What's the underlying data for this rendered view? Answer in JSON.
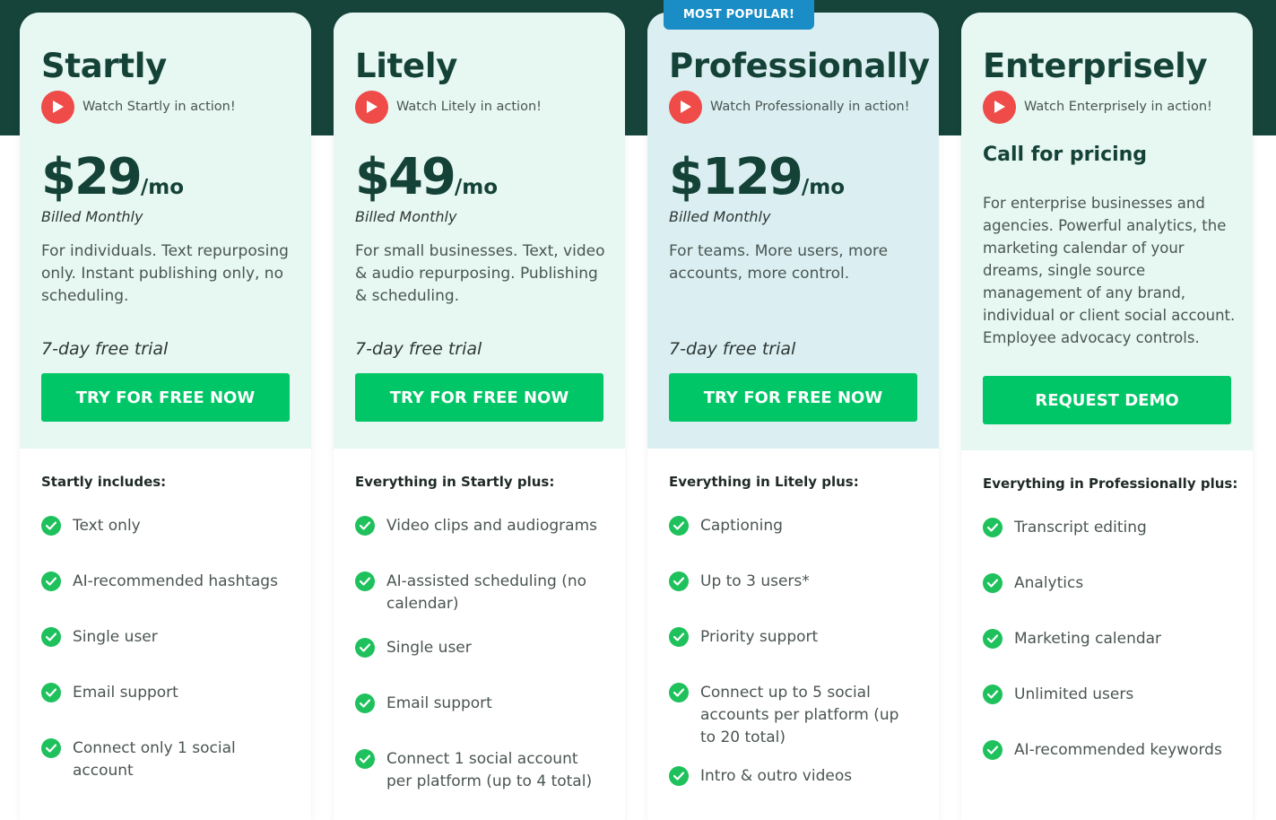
{
  "badge": "MOST POPULAR!",
  "colors": {
    "header_band": "#16443a",
    "card_top": "#e7f7f2",
    "card_top_popular": "#dbeff2",
    "cta_green": "#00c667",
    "play_red": "#ee4b49",
    "check_green": "#1ec15c",
    "badge_blue": "#1a8dc6"
  },
  "icons": {
    "watch": "play-icon",
    "feature": "check-circle-icon"
  },
  "plans": [
    {
      "name": "Startly",
      "watch": "Watch Startly in action!",
      "price": "$29",
      "unit": "/mo",
      "billed": "Billed Monthly",
      "desc": "For individuals. Text repurposing only. Instant publishing only, no scheduling.",
      "trial": "7-day free trial",
      "cta": "TRY FOR FREE NOW",
      "includes": "Startly includes:",
      "features": [
        "Text only",
        "AI-recommended hashtags",
        "Single user",
        "Email support",
        "Connect only 1 social account"
      ]
    },
    {
      "name": "Litely",
      "watch": "Watch Litely in action!",
      "price": "$49",
      "unit": "/mo",
      "billed": "Billed Monthly",
      "desc": "For small businesses. Text, video & audio repurposing. Publishing & scheduling.",
      "trial": "7-day free trial",
      "cta": "TRY FOR FREE NOW",
      "includes": "Everything in Startly plus:",
      "features": [
        "Video clips and audiograms",
        "AI-assisted scheduling (no calendar)",
        "Single user",
        "Email support",
        "Connect 1 social account per platform (up to 4 total)"
      ]
    },
    {
      "name": "Professionally",
      "watch": "Watch Professionally in action!",
      "price": "$129",
      "unit": "/mo",
      "billed": "Billed Monthly",
      "desc": "For teams. More users, more accounts, more control.",
      "trial": "7-day free trial",
      "cta": "TRY FOR FREE NOW",
      "includes": "Everything in Litely plus:",
      "features": [
        "Captioning",
        "Up to 3 users*",
        "Priority support",
        "Connect up to 5 social accounts per platform (up to 20 total)",
        "Intro & outro videos"
      ]
    },
    {
      "name": "Enterprisely",
      "watch": "Watch Enterprisely in action!",
      "call": "Call for pricing",
      "desc": "For enterprise businesses and agencies. Powerful analytics, the marketing calendar of your dreams, single source management of any brand, individual or client social account. Employee advocacy controls.",
      "cta": "REQUEST DEMO",
      "includes": "Everything in Professionally plus:",
      "features": [
        "Transcript editing",
        "Analytics",
        "Marketing calendar",
        "Unlimited users",
        "AI-recommended keywords"
      ]
    }
  ]
}
